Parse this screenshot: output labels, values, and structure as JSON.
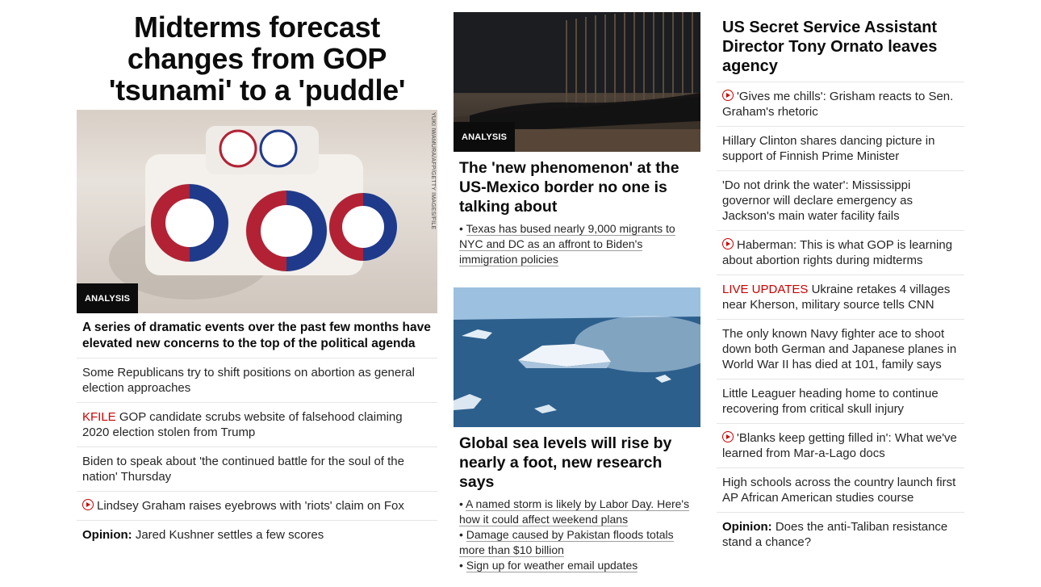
{
  "left": {
    "headline": "Midterms forecast changes from GOP 'tsunami' to a 'puddle'",
    "image_credit": "YUKI IWAMURA/AFP/GETTY IMAGES/FILE",
    "badge": "ANALYSIS",
    "subhead": "A series of dramatic events over the past few months have elevated new concerns to the top of the political agenda",
    "items": [
      {
        "prefix": "",
        "text": "Some Republicans try to shift positions on abortion as general election approaches"
      },
      {
        "prefix": "KFILE",
        "text": " GOP candidate scrubs website of falsehood claiming 2020 election stolen from Trump"
      },
      {
        "prefix": "",
        "text": "Biden to speak about 'the continued battle for the soul of the nation' Thursday"
      },
      {
        "prefix": "",
        "text": "Lindsey Graham raises eyebrows with 'riots' claim on Fox"
      },
      {
        "prefix": "Opinion:",
        "text": " Jared Kushner settles a few scores"
      }
    ]
  },
  "mid": {
    "story1": {
      "badge": "ANALYSIS",
      "headline": "The 'new phenomenon' at the US-Mexico border no one is talking about",
      "bullets": [
        "Texas has bused nearly 9,000 migrants to NYC and DC as an affront to Biden's immigration policies"
      ]
    },
    "story2": {
      "headline": "Global sea levels will rise by nearly a foot, new research says",
      "bullets": [
        "A named storm is likely by Labor Day. Here's how it could affect weekend plans",
        "Damage caused by Pakistan floods totals more than $10 billion",
        "Sign up for weather email updates"
      ]
    }
  },
  "right": {
    "headline": "US Secret Service Assistant Director Tony Ornato leaves agency",
    "items": [
      {
        "prefix": "",
        "text": "'Gives me chills': Grisham reacts to Sen. Graham's rhetoric"
      },
      {
        "prefix": "",
        "text": "Hillary Clinton shares dancing picture in support of Finnish Prime Minister"
      },
      {
        "prefix": "",
        "text": "'Do not drink the water': Mississippi governor will declare emergency as Jackson's main water facility fails"
      },
      {
        "prefix": "",
        "text": "Haberman: This is what GOP is learning about abortion rights during midterms"
      },
      {
        "prefix": "LIVE UPDATES",
        "text": " Ukraine retakes 4 villages near Kherson, military source tells CNN"
      },
      {
        "prefix": "",
        "text": "The only known Navy fighter ace to shoot down both German and Japanese planes in World War II has died at 101, family says"
      },
      {
        "prefix": "",
        "text": "Little Leaguer heading home to continue recovering from critical skull injury"
      },
      {
        "prefix": "",
        "text": "'Blanks keep getting filled in': What we've learned from Mar-a-Lago docs"
      },
      {
        "prefix": "",
        "text": "High schools across the country launch first AP African American studies course"
      },
      {
        "prefix": "Opinion:",
        "text": " Does the anti-Taliban resistance stand a chance?"
      }
    ]
  },
  "colors": {
    "accent_red": "#cc0000",
    "text": "#0c0c0c",
    "divider": "#e6e6e6"
  }
}
